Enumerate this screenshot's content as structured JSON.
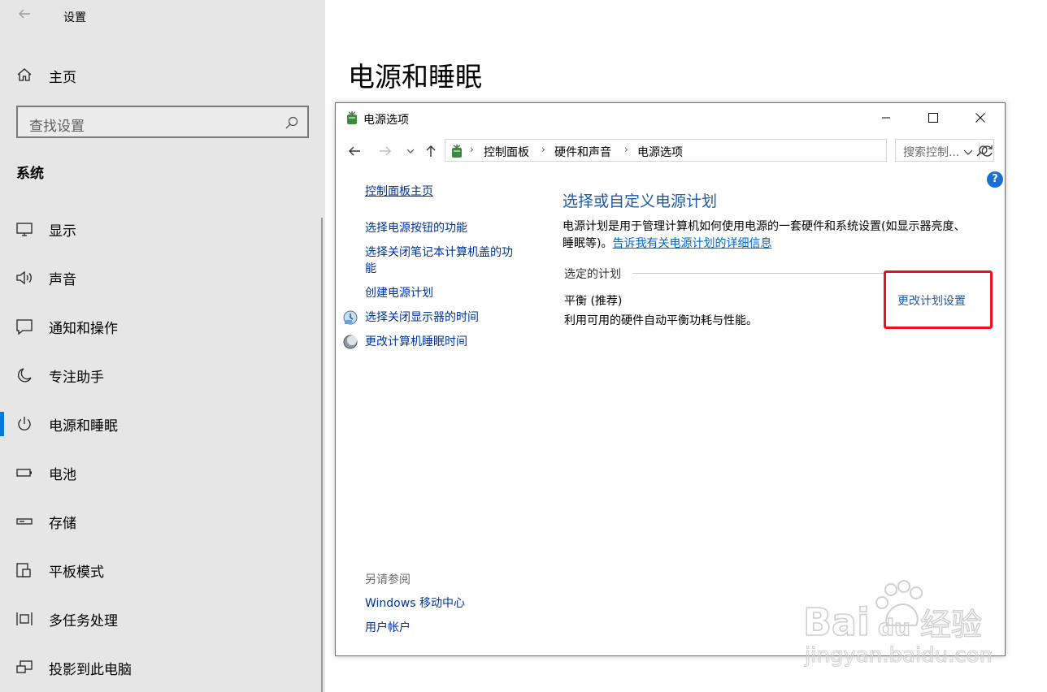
{
  "sidebar": {
    "app_title": "设置",
    "home_label": "主页",
    "search_placeholder": "查找设置",
    "section_title": "系统",
    "items": [
      {
        "label": "显示",
        "icon": "monitor-icon"
      },
      {
        "label": "声音",
        "icon": "speaker-icon"
      },
      {
        "label": "通知和操作",
        "icon": "notification-icon"
      },
      {
        "label": "专注助手",
        "icon": "moon-icon"
      },
      {
        "label": "电源和睡眠",
        "icon": "power-icon",
        "active": true
      },
      {
        "label": "电池",
        "icon": "battery-icon"
      },
      {
        "label": "存储",
        "icon": "storage-icon"
      },
      {
        "label": "平板模式",
        "icon": "tablet-icon"
      },
      {
        "label": "多任务处理",
        "icon": "multitask-icon"
      },
      {
        "label": "投影到此电脑",
        "icon": "project-icon"
      }
    ]
  },
  "main": {
    "page_title": "电源和睡眠"
  },
  "control_panel": {
    "window_title": "电源选项",
    "breadcrumb": [
      "控制面板",
      "硬件和声音",
      "电源选项"
    ],
    "search_placeholder": "搜索控制...",
    "help_label": "?",
    "left_links": {
      "home": "控制面板主页",
      "power_buttons": "选择电源按钮的功能",
      "lid_close_line1": "选择关闭笔记本计算机盖的功",
      "lid_close_line2": "能",
      "create_plan": "创建电源计划",
      "display_off": "选择关闭显示器的时间",
      "sleep_time": "更改计算机睡眠时间"
    },
    "see_also": {
      "label": "另请参阅",
      "links": [
        "Windows 移动中心",
        "用户帐户"
      ]
    },
    "content": {
      "heading": "选择或自定义电源计划",
      "description_line1": "电源计划是用于管理计算机如何使用电源的一套硬件和系统设置(如显示器亮度、",
      "description_line2_prefix": "睡眠等)。",
      "description_link": "告诉我有关电源计划的详细信息",
      "selected_plan_label": "选定的计划",
      "plan_name": "平衡 (推荐)",
      "plan_description": "利用可用的硬件自动平衡功耗与性能。",
      "change_plan_link": "更改计划设置"
    }
  },
  "watermark": {
    "brand_latin": "Bai",
    "brand_du": "du",
    "brand_cn": "经验",
    "url": "jingyan.baidu.com"
  },
  "colors": {
    "accent": "#0078d7",
    "link": "#003399",
    "heading_blue": "#1e5aa8",
    "highlight_red": "#e8141b",
    "sidebar_bg": "#e6e6e6"
  }
}
